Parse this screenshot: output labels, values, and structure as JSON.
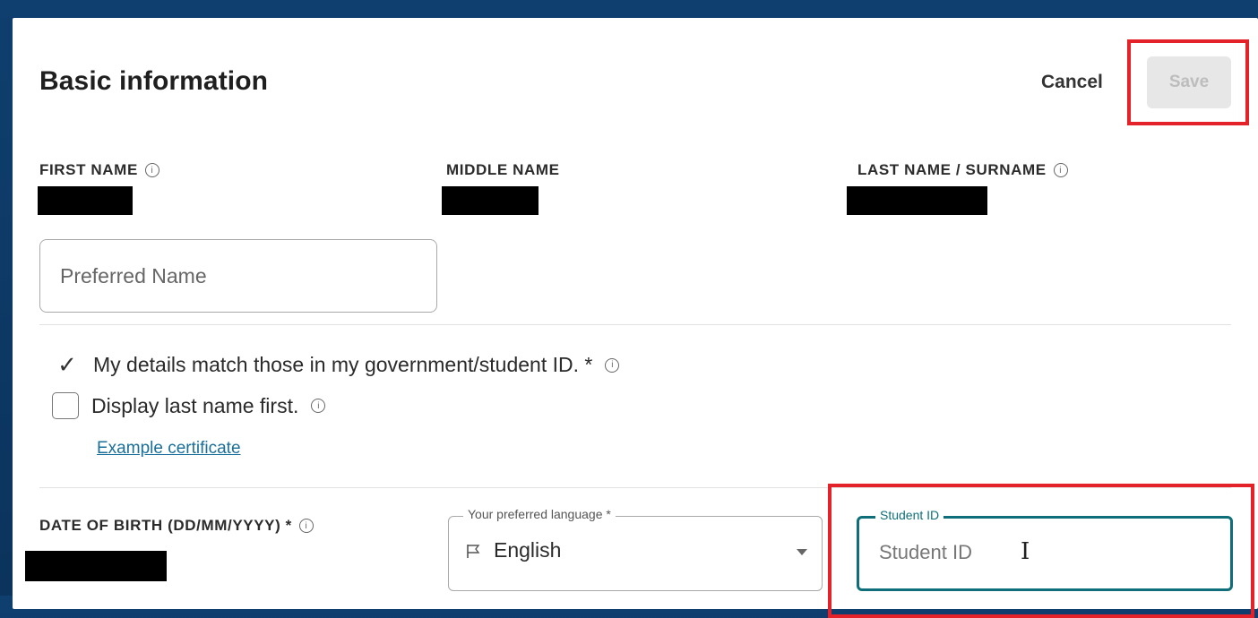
{
  "form": {
    "title": "Basic information",
    "cancel_label": "Cancel",
    "save_label": "Save"
  },
  "names": {
    "first_label": "FIRST NAME",
    "middle_label": "MIDDLE NAME",
    "last_label": "LAST NAME / SURNAME",
    "preferred_placeholder": "Preferred Name"
  },
  "checks": {
    "match_label": "My details match those in my government/student ID. *",
    "match_checked": true,
    "display_last_label": "Display last name first.",
    "display_last_checked": false,
    "example_link": "Example certificate"
  },
  "dob": {
    "label": "DATE OF BIRTH (DD/MM/YYYY) *"
  },
  "language": {
    "legend": "Your preferred language *",
    "value": "English"
  },
  "student_id": {
    "legend": "Student ID",
    "placeholder": "Student ID"
  },
  "icons": {
    "info": "i",
    "check": "✓",
    "text_cursor": "I"
  },
  "colors": {
    "background": "#0f3f6f",
    "highlight": "#e4222a",
    "accent_teal": "#0e6f7a",
    "link": "#1a6f9a"
  }
}
